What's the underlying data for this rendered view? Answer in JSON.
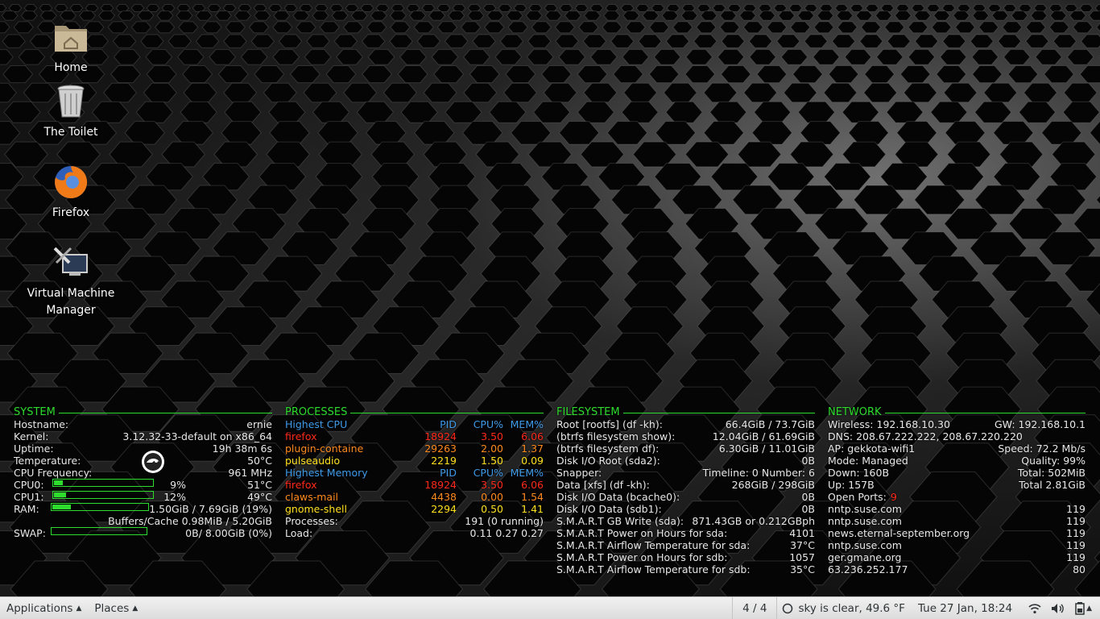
{
  "desktop": {
    "icons": [
      {
        "label": "Home",
        "icon": "home-folder-icon"
      },
      {
        "label": "The Toilet",
        "icon": "trash-icon"
      },
      {
        "label": "Firefox",
        "icon": "firefox-icon"
      },
      {
        "label": "Virtual Machine Manager",
        "icon": "virt-manager-icon"
      }
    ]
  },
  "conky": {
    "system": {
      "title": "SYSTEM",
      "hostname_label": "Hostname:",
      "hostname": "ernie",
      "kernel_label": "Kernel:",
      "kernel": "3.12.32-33-default on x86_64",
      "uptime_label": "Uptime:",
      "uptime": "19h 38m 6s",
      "temp_label": "Temperature:",
      "temp": "50°C",
      "cpufreq_label": "CPU Frequency:",
      "cpufreq": "961 MHz",
      "cpu0_label": "CPU0:",
      "cpu0_pct": "9%",
      "cpu0_temp": "51°C",
      "cpu0_fill": 0.09,
      "cpu1_label": "CPU1:",
      "cpu1_pct": "12%",
      "cpu1_temp": "49°C",
      "cpu1_fill": 0.12,
      "ram_label": "RAM:",
      "ram": "1.50GiB / 7.69GiB (19%)",
      "ram_fill": 0.19,
      "buffers": "Buffers/Cache 0.98MiB / 5.20GiB",
      "swap_label": "SWAP:",
      "swap_used": "0B",
      "swap_rest": "/ 8.00GiB (0%)",
      "swap_fill": 0
    },
    "processes": {
      "title": "PROCESSES",
      "cpu_header": "Highest CPU",
      "mem_header": "Highest Memory",
      "col_pid": "PID",
      "col_cpu": "CPU%",
      "col_mem": "MEM%",
      "cpu_rows": [
        {
          "name": "firefox",
          "pid": "18924",
          "cpu": "3.50",
          "mem": "6.06",
          "color": "#ff2a1a"
        },
        {
          "name": "plugin-containe",
          "pid": "29263",
          "cpu": "2.00",
          "mem": "1.37",
          "color": "#ff8a1e"
        },
        {
          "name": "pulseaudio",
          "pid": "2219",
          "cpu": "1.50",
          "mem": "0.09",
          "color": "#ffe020"
        }
      ],
      "mem_rows": [
        {
          "name": "firefox",
          "pid": "18924",
          "cpu": "3.50",
          "mem": "6.06",
          "color": "#ff2a1a"
        },
        {
          "name": "claws-mail",
          "pid": "4438",
          "cpu": "0.00",
          "mem": "1.54",
          "color": "#ff8a1e"
        },
        {
          "name": "gnome-shell",
          "pid": "2294",
          "cpu": "0.50",
          "mem": "1.41",
          "color": "#ffe020"
        }
      ],
      "processes_label": "Processes:",
      "processes": "191 (0 running)",
      "load_label": "Load:",
      "load": "0.11 0.27 0.27"
    },
    "filesystem": {
      "title": "FILESYSTEM",
      "rows": [
        {
          "label": "Root [rootfs] (df -kh):",
          "value": "66.4GiB / 73.7GiB"
        },
        {
          "label": "(btrfs filesystem show):",
          "value": "12.04GiB / 61.69GiB"
        },
        {
          "label": "(btrfs filesystem df):",
          "value": "6.30GiB / 11.01GiB"
        },
        {
          "label": "Disk I/O Root (sda2):",
          "value": "0B"
        },
        {
          "label": "Snapper:",
          "value": "Timeline: 0 Number: 6"
        },
        {
          "label": "Data [xfs] (df -kh):",
          "value": "268GiB / 298GiB"
        },
        {
          "label": "Disk I/O Data (bcache0):",
          "value": "0B"
        },
        {
          "label": "Disk I/O Data (sdb1):",
          "value": "0B"
        },
        {
          "label": "S.M.A.R.T GB Write (sda):",
          "value": "871.43GB or 0.212GBph"
        },
        {
          "label": "S.M.A.R.T Power on Hours for sda:",
          "value": "4101"
        },
        {
          "label": "S.M.A.R.T Airflow Temperature for sda:",
          "value": "37°C"
        },
        {
          "label": "S.M.A.R.T Power on Hours for sdb:",
          "value": "1057"
        },
        {
          "label": "S.M.A.R.T Airflow Temperature for sdb:",
          "value": "35°C"
        }
      ]
    },
    "network": {
      "title": "NETWORK",
      "rows": [
        {
          "label": "Wireless: 192.168.10.30",
          "value": "GW: 192.168.10.1"
        },
        {
          "label": "DNS: 208.67.222.222, 208.67.220.220",
          "value": ""
        },
        {
          "label": "AP: gekkota-wifi1",
          "value": "Speed: 72.2 Mb/s"
        },
        {
          "label": "Mode: Managed",
          "value": "Quality: 99%"
        },
        {
          "label": "Down: 160B",
          "value": "Total: 502MiB"
        },
        {
          "label": "Up: 157B",
          "value": "Total 2.81GiB"
        }
      ],
      "open_ports_label": "Open Ports:",
      "open_ports": "9",
      "ports": [
        {
          "host": "nntp.suse.com",
          "port": "119"
        },
        {
          "host": "nntp.suse.com",
          "port": "119"
        },
        {
          "host": "news.eternal-september.org",
          "port": "119"
        },
        {
          "host": "nntp.suse.com",
          "port": "119"
        },
        {
          "host": "ger.gmane.org",
          "port": "119"
        },
        {
          "host": "63.236.252.177",
          "port": "80"
        }
      ]
    }
  },
  "panel": {
    "applications": "Applications",
    "places": "Places",
    "workspace": "4 / 4",
    "weather": "sky is clear, 49.6 °F",
    "clock": "Tue 27 Jan, 18:24"
  },
  "colors": {
    "accent": "#2ddc2d",
    "blue": "#3f9ae8",
    "panel": "#e8e8e8"
  }
}
